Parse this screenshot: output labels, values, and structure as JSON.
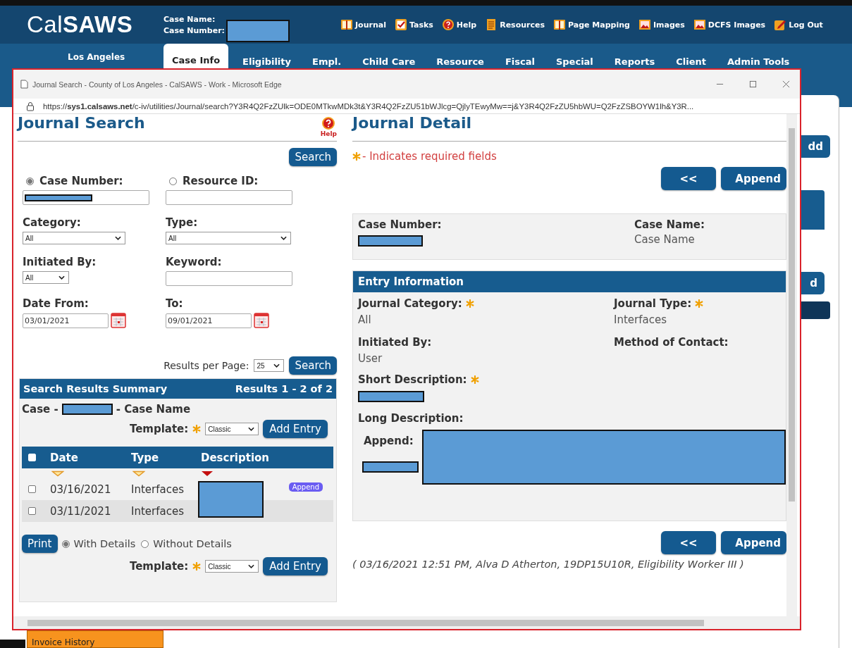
{
  "app_header": {
    "logo": "Cal**SAWS**",
    "case_name_label": "Case Name:",
    "case_number_label": "Case Number:",
    "links": [
      {
        "label": "Journal",
        "kind": "book"
      },
      {
        "label": "Tasks",
        "kind": "check"
      },
      {
        "label": "Help",
        "kind": "help"
      },
      {
        "label": "Resources",
        "kind": "document"
      },
      {
        "label": "Page Mapping",
        "kind": "book"
      },
      {
        "label": "Images",
        "kind": "picture"
      },
      {
        "label": "DCFS Images",
        "kind": "picture"
      },
      {
        "label": "Log Out",
        "kind": "edit"
      }
    ]
  },
  "nav": {
    "region": "Los Angeles",
    "tabs": [
      {
        "label": "Case Info",
        "selected": true
      },
      {
        "label": "Eligibility",
        "selected": false
      },
      {
        "label": "Empl.",
        "selected": false
      },
      {
        "label": "Child Care",
        "selected": false
      },
      {
        "label": "Resource",
        "selected": false
      },
      {
        "label": "Fiscal",
        "selected": false
      },
      {
        "label": "Special",
        "selected": false
      },
      {
        "label": "Reports",
        "selected": false
      },
      {
        "label": "Client",
        "selected": false
      },
      {
        "label": "Admin Tools",
        "selected": false
      }
    ]
  },
  "background": {
    "side_buttons": [
      "dd",
      "d"
    ],
    "side_menu_item": "Invoice History"
  },
  "browser_window": {
    "title": "Journal Search - County of Los Angeles - CalSAWS - Work - Microsoft Edge",
    "url": "https://**sys1.calsaws.net**/c-iv/utilities/Journal/search?Y3R4Q2FzZUlk=ODE0MTkwMDk3t&Y3R4Q2FzZU51bWJlcg=QjlyTEwyMw==j&Y3R4Q2FzZU5hbWU=Q2FzZSBOYW1lh&Y3R..."
  },
  "journal_search": {
    "title": "Journal Search",
    "help_label": "Help",
    "search_button": "Search",
    "search_by": [
      {
        "label": "Case Number:",
        "selected": true
      },
      {
        "label": "Resource ID:",
        "selected": false
      }
    ],
    "category": {
      "label": "Category:",
      "value": "All"
    },
    "type": {
      "label": "Type:",
      "value": "All"
    },
    "initiated_by": {
      "label": "Initiated By:",
      "value": "All"
    },
    "keyword": {
      "label": "Keyword:"
    },
    "date_from": {
      "label": "Date From:",
      "value": "03/01/2021"
    },
    "date_to": {
      "label": "To:",
      "value": "09/01/2021"
    },
    "results_per_page": {
      "label": "Results per Page:",
      "value": "25"
    },
    "search_button_2": "Search",
    "results": {
      "title": "Search Results Summary",
      "range": "Results 1 - 2 of 2",
      "case_prefix": "Case -",
      "case_suffix": "- Case Name",
      "template_label": "Template:",
      "template_value": "Classic",
      "add_entry_button": "Add Entry",
      "select_all_checked": false,
      "columns": [
        {
          "label": "Date",
          "sorted": false
        },
        {
          "label": "Type",
          "sorted": false
        },
        {
          "label": "Description",
          "sorted": true
        }
      ],
      "rows": [
        {
          "date": "03/16/2021",
          "type": "Interfaces",
          "checked": false,
          "badge": "Append"
        },
        {
          "date": "03/11/2021",
          "type": "Interfaces",
          "checked": false
        }
      ],
      "print_button": "Print",
      "print_options": [
        {
          "label": "With Details",
          "selected": true
        },
        {
          "label": "Without Details",
          "selected": false
        }
      ],
      "template_label_2": "Template:",
      "template_value_2": "Classic",
      "add_entry_button_2": "Add Entry"
    }
  },
  "journal_detail": {
    "title": "Journal Detail",
    "required_note": "- Indicates required fields",
    "back_button": "<<",
    "append_button": "Append",
    "case_number_label": "Case Number:",
    "case_name_label": "Case Name:",
    "case_name_value": "Case Name",
    "section_title": "Entry Information",
    "fields": [
      {
        "label": "Journal Category:",
        "required": true,
        "value": "All"
      },
      {
        "label": "Journal Type:",
        "required": true,
        "value": "Interfaces"
      },
      {
        "label": "Initiated By:",
        "required": false,
        "value": "User"
      },
      {
        "label": "Method of Contact:",
        "required": false
      }
    ],
    "short_description_label": "Short Description:",
    "short_description_required": true,
    "long_description_label": "Long Description:",
    "append_label": "Append:",
    "back_button_2": "<<",
    "append_button_2": "Append",
    "footer": "( 03/16/2021 12:51 PM, Alva D Atherton, 19DP15U10R, Eligibility Worker III )"
  }
}
